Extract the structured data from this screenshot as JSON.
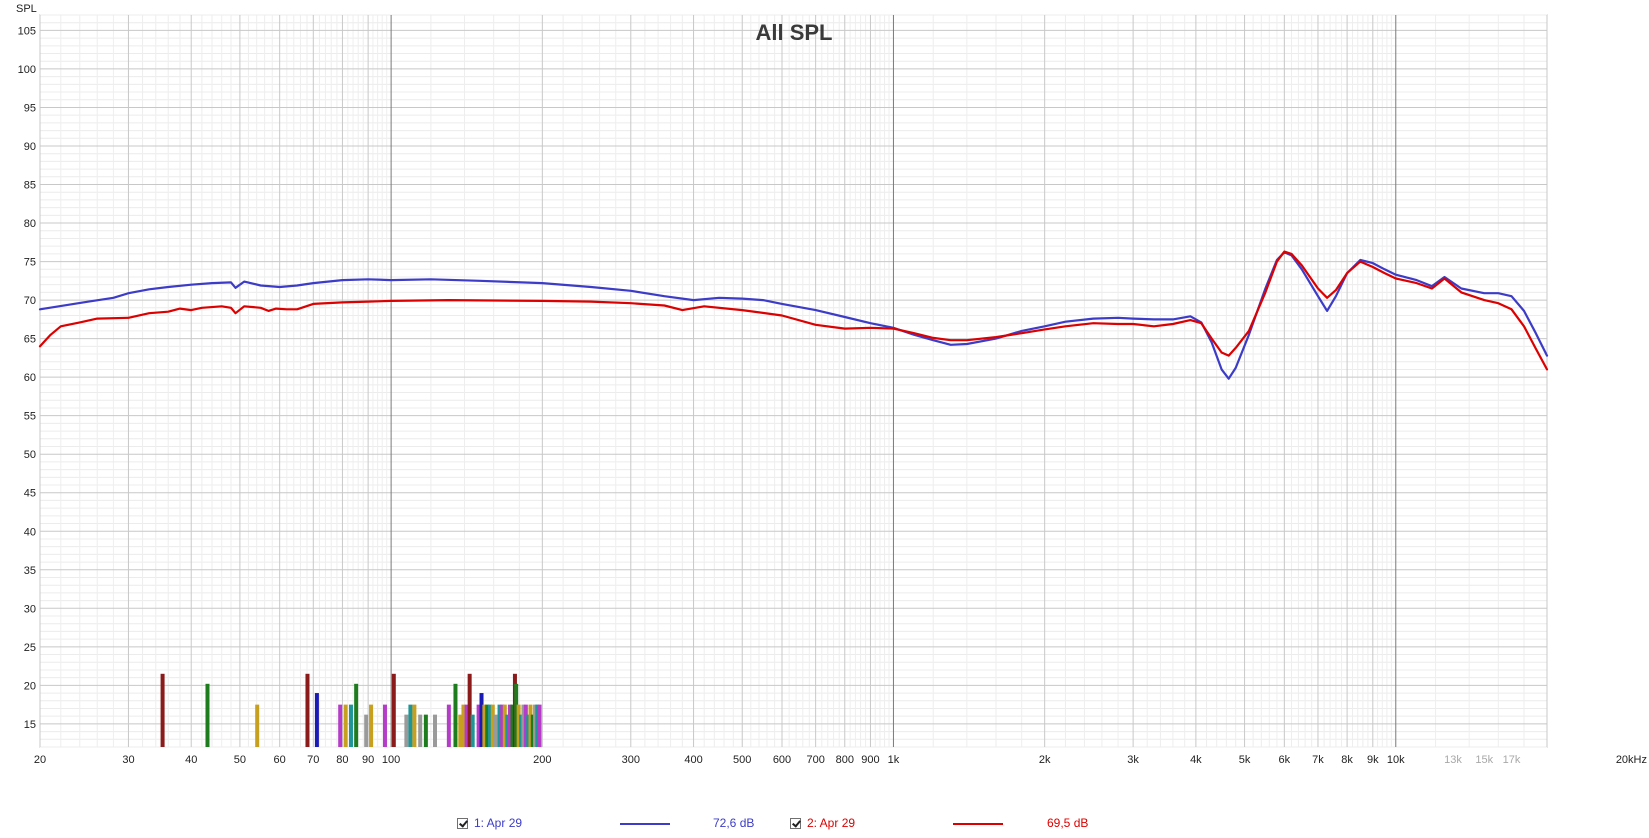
{
  "chart_data": {
    "type": "line",
    "title": "All SPL",
    "ylabel": "SPL",
    "xunit": "kHz",
    "xscale": "log",
    "xlim": [
      20,
      20000
    ],
    "ylim": [
      12,
      107
    ],
    "grid": true,
    "y_ticks": [
      15,
      20,
      25,
      30,
      35,
      40,
      45,
      50,
      55,
      60,
      65,
      70,
      75,
      80,
      85,
      90,
      95,
      100,
      105
    ],
    "x_ticks": [
      {
        "v": 20,
        "label": "20"
      },
      {
        "v": 30,
        "label": "30"
      },
      {
        "v": 40,
        "label": "40"
      },
      {
        "v": 50,
        "label": "50"
      },
      {
        "v": 60,
        "label": "60"
      },
      {
        "v": 70,
        "label": "70"
      },
      {
        "v": 80,
        "label": "80"
      },
      {
        "v": 90,
        "label": "90"
      },
      {
        "v": 100,
        "label": "100"
      },
      {
        "v": 200,
        "label": "200"
      },
      {
        "v": 300,
        "label": "300"
      },
      {
        "v": 400,
        "label": "400"
      },
      {
        "v": 500,
        "label": "500"
      },
      {
        "v": 600,
        "label": "600"
      },
      {
        "v": 700,
        "label": "700"
      },
      {
        "v": 800,
        "label": "800"
      },
      {
        "v": 900,
        "label": "900"
      },
      {
        "v": 1000,
        "label": "1k"
      },
      {
        "v": 2000,
        "label": "2k"
      },
      {
        "v": 3000,
        "label": "3k"
      },
      {
        "v": 4000,
        "label": "4k"
      },
      {
        "v": 5000,
        "label": "5k"
      },
      {
        "v": 6000,
        "label": "6k"
      },
      {
        "v": 7000,
        "label": "7k"
      },
      {
        "v": 8000,
        "label": "8k"
      },
      {
        "v": 9000,
        "label": "9k"
      },
      {
        "v": 10000,
        "label": "10k"
      },
      {
        "v": 13000,
        "label": "13k",
        "muted": true
      },
      {
        "v": 15000,
        "label": "15k",
        "muted": true
      },
      {
        "v": 17000,
        "label": "17k",
        "muted": true
      },
      {
        "v": 20000,
        "label": "20kHz"
      }
    ],
    "series": [
      {
        "name": "1: Apr 29",
        "color": "#3c3cc8",
        "level": "72,6 dB",
        "points": [
          [
            20,
            68.8
          ],
          [
            25,
            69.8
          ],
          [
            28,
            70.3
          ],
          [
            30,
            70.9
          ],
          [
            33,
            71.4
          ],
          [
            36,
            71.7
          ],
          [
            40,
            72.0
          ],
          [
            44,
            72.2
          ],
          [
            48,
            72.3
          ],
          [
            49,
            71.6
          ],
          [
            51,
            72.4
          ],
          [
            55,
            71.9
          ],
          [
            60,
            71.7
          ],
          [
            65,
            71.9
          ],
          [
            70,
            72.2
          ],
          [
            80,
            72.6
          ],
          [
            90,
            72.7
          ],
          [
            100,
            72.6
          ],
          [
            120,
            72.7
          ],
          [
            150,
            72.5
          ],
          [
            200,
            72.2
          ],
          [
            250,
            71.7
          ],
          [
            300,
            71.2
          ],
          [
            350,
            70.5
          ],
          [
            400,
            70.0
          ],
          [
            450,
            70.3
          ],
          [
            500,
            70.2
          ],
          [
            550,
            70.0
          ],
          [
            600,
            69.5
          ],
          [
            700,
            68.7
          ],
          [
            800,
            67.8
          ],
          [
            900,
            67.0
          ],
          [
            1000,
            66.4
          ],
          [
            1100,
            65.5
          ],
          [
            1200,
            64.8
          ],
          [
            1300,
            64.2
          ],
          [
            1400,
            64.3
          ],
          [
            1600,
            65.0
          ],
          [
            1800,
            66.0
          ],
          [
            2000,
            66.6
          ],
          [
            2200,
            67.2
          ],
          [
            2500,
            67.6
          ],
          [
            2800,
            67.7
          ],
          [
            3000,
            67.6
          ],
          [
            3300,
            67.5
          ],
          [
            3600,
            67.5
          ],
          [
            3900,
            67.9
          ],
          [
            4100,
            67.1
          ],
          [
            4300,
            64.5
          ],
          [
            4500,
            61.0
          ],
          [
            4650,
            59.8
          ],
          [
            4800,
            61.2
          ],
          [
            5100,
            65.5
          ],
          [
            5500,
            71.5
          ],
          [
            5800,
            75.2
          ],
          [
            6000,
            76.2
          ],
          [
            6200,
            75.8
          ],
          [
            6500,
            74.0
          ],
          [
            7000,
            70.5
          ],
          [
            7300,
            68.6
          ],
          [
            7600,
            70.5
          ],
          [
            8000,
            73.5
          ],
          [
            8500,
            75.2
          ],
          [
            9000,
            74.8
          ],
          [
            9500,
            74.0
          ],
          [
            10000,
            73.3
          ],
          [
            11000,
            72.6
          ],
          [
            11800,
            71.8
          ],
          [
            12500,
            73.0
          ],
          [
            13500,
            71.5
          ],
          [
            15000,
            70.9
          ],
          [
            16000,
            70.9
          ],
          [
            17000,
            70.5
          ],
          [
            18000,
            68.6
          ],
          [
            19000,
            65.7
          ],
          [
            20000,
            62.8
          ]
        ]
      },
      {
        "name": "2: Apr 29",
        "color": "#dc0000",
        "level": "69,5 dB",
        "points": [
          [
            20,
            64.0
          ],
          [
            21,
            65.5
          ],
          [
            22,
            66.6
          ],
          [
            24,
            67.1
          ],
          [
            26,
            67.6
          ],
          [
            30,
            67.7
          ],
          [
            33,
            68.3
          ],
          [
            36,
            68.5
          ],
          [
            38,
            68.9
          ],
          [
            40,
            68.7
          ],
          [
            42,
            69.0
          ],
          [
            46,
            69.2
          ],
          [
            48,
            69.0
          ],
          [
            49,
            68.3
          ],
          [
            51,
            69.2
          ],
          [
            55,
            69.0
          ],
          [
            57,
            68.6
          ],
          [
            59,
            68.9
          ],
          [
            62,
            68.8
          ],
          [
            65,
            68.8
          ],
          [
            70,
            69.5
          ],
          [
            80,
            69.7
          ],
          [
            90,
            69.8
          ],
          [
            100,
            69.9
          ],
          [
            130,
            70.0
          ],
          [
            200,
            69.9
          ],
          [
            250,
            69.8
          ],
          [
            300,
            69.6
          ],
          [
            350,
            69.3
          ],
          [
            380,
            68.7
          ],
          [
            420,
            69.2
          ],
          [
            500,
            68.7
          ],
          [
            600,
            68.0
          ],
          [
            700,
            66.8
          ],
          [
            800,
            66.3
          ],
          [
            900,
            66.4
          ],
          [
            1000,
            66.3
          ],
          [
            1100,
            65.7
          ],
          [
            1200,
            65.1
          ],
          [
            1300,
            64.8
          ],
          [
            1400,
            64.8
          ],
          [
            1600,
            65.2
          ],
          [
            1800,
            65.7
          ],
          [
            2000,
            66.2
          ],
          [
            2200,
            66.6
          ],
          [
            2500,
            67.0
          ],
          [
            2800,
            66.9
          ],
          [
            3000,
            66.9
          ],
          [
            3300,
            66.6
          ],
          [
            3600,
            66.9
          ],
          [
            3900,
            67.4
          ],
          [
            4100,
            67.0
          ],
          [
            4300,
            65.0
          ],
          [
            4500,
            63.2
          ],
          [
            4650,
            62.8
          ],
          [
            4800,
            63.8
          ],
          [
            5100,
            66.0
          ],
          [
            5500,
            71.0
          ],
          [
            5800,
            75.0
          ],
          [
            6000,
            76.3
          ],
          [
            6200,
            76.0
          ],
          [
            6500,
            74.5
          ],
          [
            7000,
            71.5
          ],
          [
            7300,
            70.3
          ],
          [
            7600,
            71.3
          ],
          [
            8000,
            73.5
          ],
          [
            8500,
            75.0
          ],
          [
            9000,
            74.3
          ],
          [
            9500,
            73.5
          ],
          [
            10000,
            72.8
          ],
          [
            11000,
            72.2
          ],
          [
            11800,
            71.5
          ],
          [
            12500,
            72.8
          ],
          [
            13500,
            71.0
          ],
          [
            15000,
            70.0
          ],
          [
            16000,
            69.6
          ],
          [
            17000,
            68.8
          ],
          [
            18000,
            66.6
          ],
          [
            19000,
            63.7
          ],
          [
            20000,
            61.0
          ]
        ]
      }
    ],
    "bars": [
      {
        "f": 35,
        "top": 21.5,
        "color": "#8b1a1a"
      },
      {
        "f": 43,
        "top": 20.2,
        "color": "#1e7b1e"
      },
      {
        "f": 54,
        "top": 17.5,
        "color": "#c8a020"
      },
      {
        "f": 68,
        "top": 21.5,
        "color": "#8b1a1a"
      },
      {
        "f": 71,
        "top": 19.0,
        "color": "#1a1ab4"
      },
      {
        "f": 79,
        "top": 17.5,
        "color": "#b43cc8"
      },
      {
        "f": 81,
        "top": 17.5,
        "color": "#c8a020"
      },
      {
        "f": 83,
        "top": 17.5,
        "color": "#1e9696"
      },
      {
        "f": 85,
        "top": 20.2,
        "color": "#1e7b1e"
      },
      {
        "f": 89,
        "top": 16.2,
        "color": "#9a9a9a"
      },
      {
        "f": 91,
        "top": 17.5,
        "color": "#c8a020"
      },
      {
        "f": 97,
        "top": 17.5,
        "color": "#b43cc8"
      },
      {
        "f": 101,
        "top": 21.5,
        "color": "#8b1a1a"
      },
      {
        "f": 107,
        "top": 16.2,
        "color": "#9a9a9a"
      },
      {
        "f": 109,
        "top": 17.5,
        "color": "#1e9696"
      },
      {
        "f": 111,
        "top": 17.5,
        "color": "#c8a020"
      },
      {
        "f": 114,
        "top": 16.2,
        "color": "#9a9a9a"
      },
      {
        "f": 117,
        "top": 16.2,
        "color": "#1e7b1e"
      },
      {
        "f": 122,
        "top": 16.2,
        "color": "#9a9a9a"
      },
      {
        "f": 130,
        "top": 17.5,
        "color": "#b43cc8"
      },
      {
        "f": 134,
        "top": 20.2,
        "color": "#1e7b1e"
      },
      {
        "f": 137,
        "top": 16.2,
        "color": "#c8a020"
      },
      {
        "f": 139,
        "top": 17.5,
        "color": "#c8a020"
      },
      {
        "f": 141,
        "top": 17.5,
        "color": "#b43cc8"
      },
      {
        "f": 143,
        "top": 21.5,
        "color": "#8b1a1a"
      },
      {
        "f": 145,
        "top": 16.2,
        "color": "#1e9696"
      },
      {
        "f": 149,
        "top": 17.5,
        "color": "#b43cc8"
      },
      {
        "f": 151,
        "top": 19.0,
        "color": "#1a1ab4"
      },
      {
        "f": 153,
        "top": 17.5,
        "color": "#c8a020"
      },
      {
        "f": 155,
        "top": 17.5,
        "color": "#1e7b1e"
      },
      {
        "f": 157,
        "top": 17.5,
        "color": "#1e9696"
      },
      {
        "f": 159,
        "top": 17.5,
        "color": "#c8a020"
      },
      {
        "f": 161,
        "top": 16.2,
        "color": "#9a9a9a"
      },
      {
        "f": 164,
        "top": 17.5,
        "color": "#1e9696"
      },
      {
        "f": 166,
        "top": 17.5,
        "color": "#b43cc8"
      },
      {
        "f": 168,
        "top": 17.5,
        "color": "#c8a020"
      },
      {
        "f": 170,
        "top": 16.2,
        "color": "#1e9696"
      },
      {
        "f": 172,
        "top": 17.5,
        "color": "#b43cc8"
      },
      {
        "f": 174,
        "top": 17.5,
        "color": "#1e7b1e"
      },
      {
        "f": 176,
        "top": 21.5,
        "color": "#8b1a1a"
      },
      {
        "f": 177,
        "top": 20.2,
        "color": "#1e7b1e"
      },
      {
        "f": 179,
        "top": 17.5,
        "color": "#c8a020"
      },
      {
        "f": 181,
        "top": 16.2,
        "color": "#1e9696"
      },
      {
        "f": 183,
        "top": 17.5,
        "color": "#9a9a9a"
      },
      {
        "f": 185,
        "top": 17.5,
        "color": "#b43cc8"
      },
      {
        "f": 187,
        "top": 16.2,
        "color": "#1e9696"
      },
      {
        "f": 189,
        "top": 17.5,
        "color": "#c8a020"
      },
      {
        "f": 191,
        "top": 16.2,
        "color": "#1e7b1e"
      },
      {
        "f": 193,
        "top": 17.5,
        "color": "#9a9a9a"
      },
      {
        "f": 195,
        "top": 17.5,
        "color": "#1e9696"
      },
      {
        "f": 197,
        "top": 17.5,
        "color": "#b43cc8"
      }
    ]
  },
  "legend": [
    {
      "label": "1: Apr 29",
      "level": "72,6 dB",
      "color": "#3c3cc8",
      "checked": true
    },
    {
      "label": "2: Apr 29",
      "level": "69,5 dB",
      "color": "#dc0000",
      "checked": true
    }
  ]
}
